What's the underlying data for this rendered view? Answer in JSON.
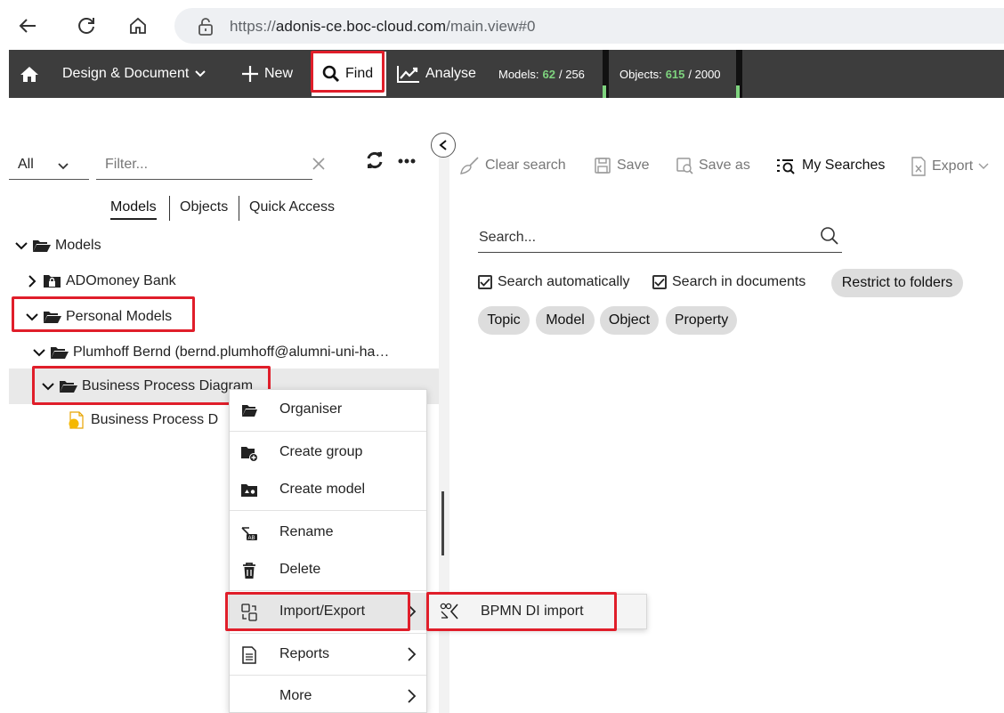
{
  "browser": {
    "url_host": "adonis-ce.boc-cloud.com",
    "url_prefix": "https://",
    "url_path": "/main.view#0"
  },
  "toolbar": {
    "design_label": "Design & Document",
    "new_label": "New",
    "find_label": "Find",
    "analyse_label": "Analyse",
    "models_label": "Models:",
    "models_count": "62",
    "models_max": "/ 256",
    "objects_label": "Objects:",
    "objects_count": "615",
    "objects_max": "/ 2000"
  },
  "left": {
    "filter_scope": "All",
    "filter_placeholder": "Filter...",
    "tabs": [
      "Models",
      "Objects",
      "Quick Access"
    ],
    "tree": {
      "root": "Models",
      "bank": "ADOmoney Bank",
      "personal": "Personal Models",
      "user": "Plumhoff Bernd (bernd.plumhoff@alumni-uni-ha…",
      "bpd_folder": "Business Process Diagram",
      "bpd_model": "Business Process D"
    }
  },
  "right": {
    "actions": {
      "clear": "Clear search",
      "save": "Save",
      "save_as": "Save as",
      "my_searches": "My Searches",
      "export": "Export"
    },
    "search_placeholder": "Search...",
    "options": {
      "auto": "Search automatically",
      "docs": "Search in documents",
      "restrict": "Restrict to folders"
    },
    "chips": [
      "Topic",
      "Model",
      "Object",
      "Property"
    ]
  },
  "menu": {
    "items": [
      "Organiser",
      "Create group",
      "Create model",
      "Rename",
      "Delete",
      "Import/Export",
      "Reports",
      "More"
    ],
    "submenu": "BPMN DI import"
  },
  "colors": {
    "toolbar_bg": "#3d3d3d",
    "highlight_red": "#e01e2a",
    "count_green": "#7ed37e",
    "folder_yellow": "#f5b800"
  }
}
